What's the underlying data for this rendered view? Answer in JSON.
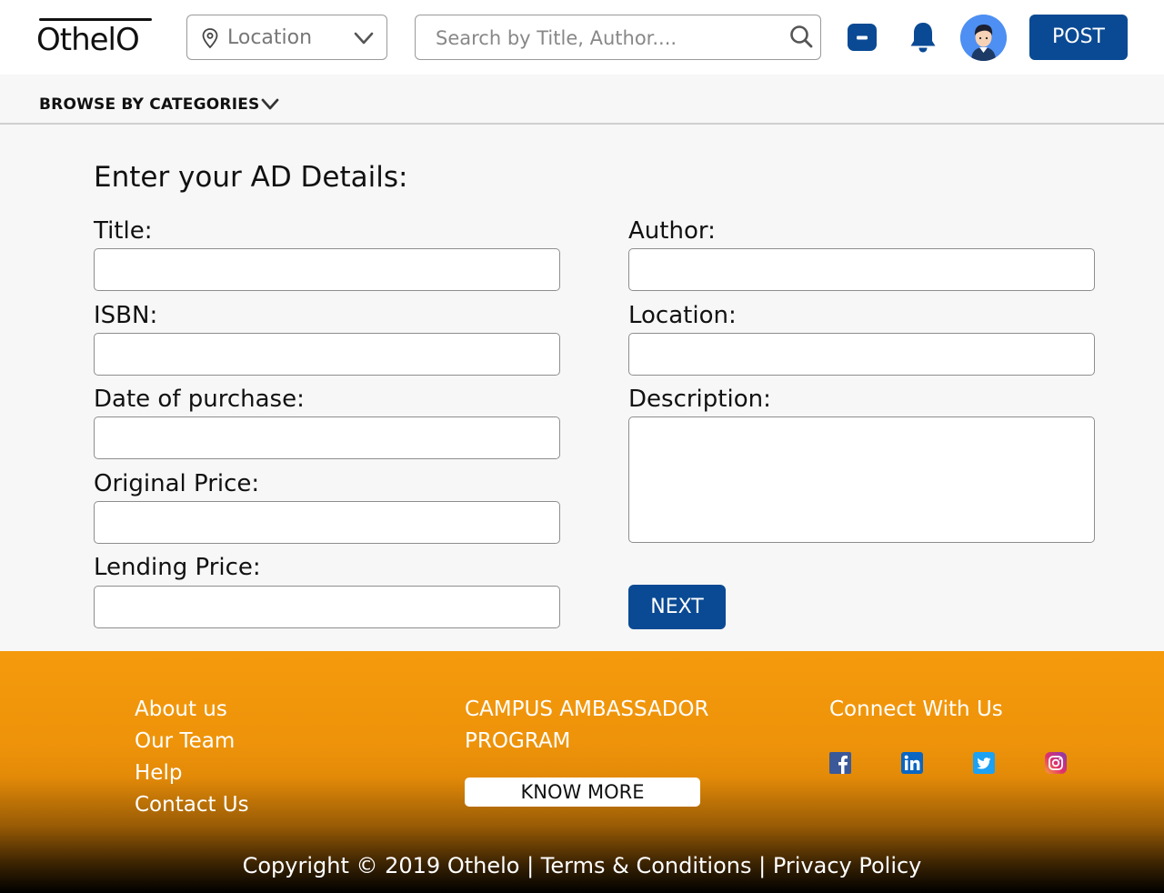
{
  "header": {
    "logo_text": "OthelO",
    "location_placeholder": "Location",
    "search_placeholder": "Search by Title, Author....",
    "post_label": "POST"
  },
  "categories": {
    "label": "BROWSE BY CATEGORIES"
  },
  "form": {
    "heading": "Enter your AD Details:",
    "fields": {
      "title": {
        "label": "Title:",
        "value": ""
      },
      "author": {
        "label": "Author:",
        "value": ""
      },
      "isbn": {
        "label": "ISBN:",
        "value": ""
      },
      "location": {
        "label": "Location:",
        "value": ""
      },
      "date_of_purchase": {
        "label": "Date of purchase:",
        "value": ""
      },
      "description": {
        "label": "Description:",
        "value": ""
      },
      "original_price": {
        "label": "Original Price:",
        "value": ""
      },
      "lending_price": {
        "label": "Lending Price:",
        "value": ""
      }
    },
    "next_label": "NEXT"
  },
  "footer": {
    "links": [
      "About us",
      "Our Team",
      "Help",
      "Contact Us"
    ],
    "campus_line1": "CAMPUS AMBASSADOR",
    "campus_line2": "PROGRAM",
    "know_more_label": "KNOW MORE",
    "connect_heading": "Connect With Us",
    "social_icons": [
      "facebook-icon",
      "linkedin-icon",
      "twitter-icon",
      "instagram-icon"
    ],
    "copyright": "Copyright © 2019 Othelo | Terms & Conditions | Privacy Policy"
  },
  "colors": {
    "brand_blue": "#0a4a94",
    "footer_orange": "#f59a0c",
    "avatar_blue": "#4d8ff2"
  }
}
